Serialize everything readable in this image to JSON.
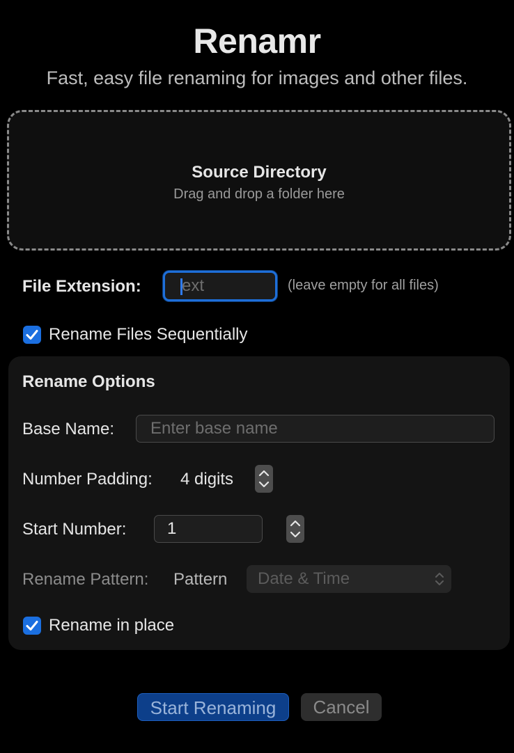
{
  "header": {
    "title": "Renamr",
    "subtitle": "Fast, easy file renaming for images and other files."
  },
  "drop_zone": {
    "title": "Source Directory",
    "hint": "Drag and drop a folder here"
  },
  "extension": {
    "label": "File Extension:",
    "placeholder": "ext",
    "hint": "(leave empty for all files)"
  },
  "sequential": {
    "label": "Rename Files Sequentially",
    "checked": true
  },
  "options": {
    "title": "Rename Options",
    "base_name_label": "Base Name:",
    "base_name_placeholder": "Enter base name",
    "padding_label": "Number Padding:",
    "padding_value": "4 digits",
    "start_label": "Start Number:",
    "start_value": "1",
    "pattern_label": "Rename Pattern:",
    "pattern_sublabel": "Pattern",
    "pattern_value": "Date & Time",
    "in_place_label": "Rename in place",
    "in_place_checked": true
  },
  "actions": {
    "start_label": "Start Renaming",
    "cancel_label": "Cancel"
  },
  "colors": {
    "accent": "#1b6fe0",
    "background": "#000000",
    "panel": "#141414"
  }
}
